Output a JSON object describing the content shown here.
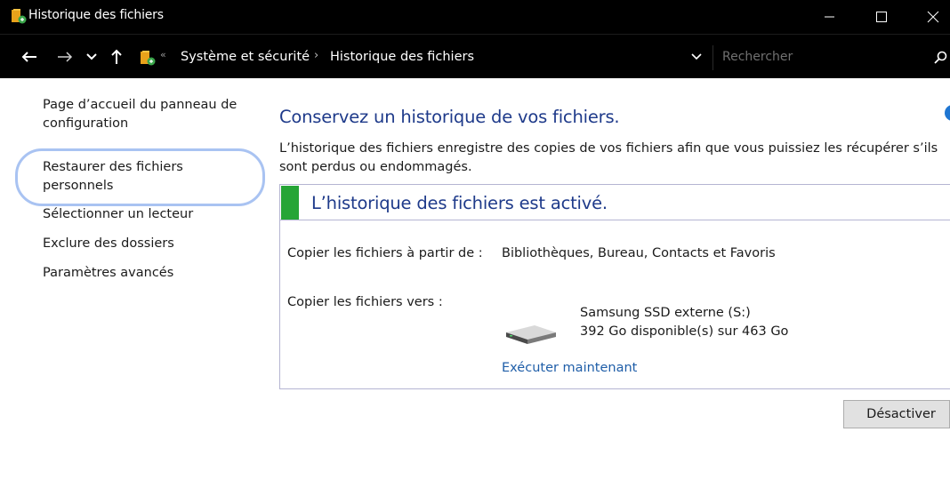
{
  "window": {
    "title": "Historique des fichiers",
    "controls": {
      "minimize": "—",
      "maximize": "☐",
      "close": "✕"
    }
  },
  "addressbar": {
    "overflow": "«",
    "breadcrumbs": [
      "Système et sécurité",
      "Historique des fichiers"
    ],
    "separator": "›",
    "search_placeholder": "Rechercher"
  },
  "sidebar": {
    "items": [
      {
        "label": "Page d’accueil du panneau de configuration"
      },
      {
        "label": "Restaurer des fichiers personnels",
        "highlighted": true
      },
      {
        "label": "Sélectionner un lecteur"
      },
      {
        "label": "Exclure des dossiers"
      },
      {
        "label": "Paramètres avancés"
      }
    ]
  },
  "main": {
    "heading": "Conservez un historique de vos fichiers.",
    "description": "L’historique des fichiers enregistre des copies de vos fichiers afin que vous puissiez les récupérer s’ils sont perdus ou endommagés.",
    "status": {
      "text": "L’historique des fichiers est activé.",
      "color": "#26a536"
    },
    "copy_from_label": "Copier les fichiers à partir de :",
    "copy_from_value": "Bibliothèques, Bureau, Contacts et Favoris",
    "copy_to_label": "Copier les fichiers vers :",
    "drive_name": "Samsung SSD externe (S:)",
    "drive_space": "392 Go disponible(s) sur 463 Go",
    "run_now": "Exécuter maintenant",
    "disable_button": "Désactiver"
  },
  "colors": {
    "titlebar": "#000000",
    "heading": "#1e3a8a",
    "link": "#1f5ea8",
    "highlight_ring": "#a9c3f2"
  }
}
